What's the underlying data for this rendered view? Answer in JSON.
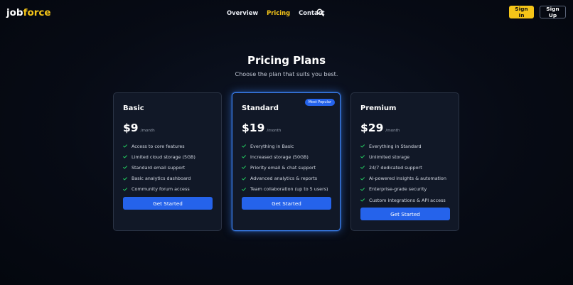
{
  "header": {
    "logo_main": "job",
    "logo_accent": "force",
    "nav": [
      {
        "label": "Overview",
        "active": false
      },
      {
        "label": "Pricing",
        "active": true
      },
      {
        "label": "Contact",
        "active": false
      }
    ],
    "search_icon": "search-icon",
    "signin_label": "Sign In",
    "signup_label": "Sign Up"
  },
  "hero": {
    "title": "Pricing Plans",
    "subtitle": "Choose the plan that suits you best."
  },
  "plans": [
    {
      "name": "Basic",
      "price": "$9",
      "period": "/month",
      "badge": "",
      "features": [
        "Access to core features",
        "Limited cloud storage (5GB)",
        "Standard email support",
        "Basic analytics dashboard",
        "Community forum access"
      ],
      "cta": "Get Started"
    },
    {
      "name": "Standard",
      "price": "$19",
      "period": "/month",
      "badge": "Most Popular",
      "features": [
        "Everything in Basic",
        "Increased storage (50GB)",
        "Priority email & chat support",
        "Advanced analytics & reports",
        "Team collaboration (up to 5 users)"
      ],
      "cta": "Get Started"
    },
    {
      "name": "Premium",
      "price": "$29",
      "period": "/month",
      "badge": "",
      "features": [
        "Everything in Standard",
        "Unlimited storage",
        "24/7 dedicated support",
        "AI-powered insights & automation",
        "Enterprise-grade security",
        "Custom integrations & API access"
      ],
      "cta": "Get Started"
    }
  ],
  "colors": {
    "accent": "#f5c518",
    "primary": "#2563eb",
    "check": "#22c55e",
    "card_bg": "#111827",
    "page_bg": "#050912"
  }
}
